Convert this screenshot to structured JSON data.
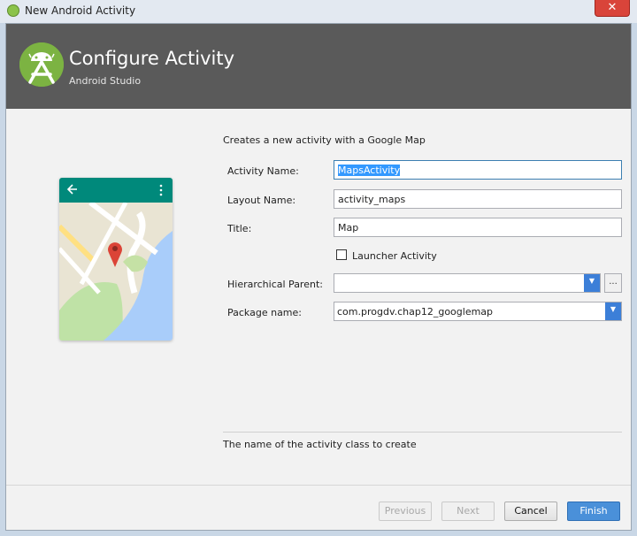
{
  "window": {
    "title": "New Android Activity",
    "close_label": "✕"
  },
  "header": {
    "title": "Configure Activity",
    "subtitle": "Android Studio"
  },
  "form": {
    "description": "Creates a new activity with a Google Map",
    "activity_name": {
      "label": "Activity Name:",
      "value": "MapsActivity"
    },
    "layout_name": {
      "label": "Layout Name:",
      "value": "activity_maps"
    },
    "title": {
      "label": "Title:",
      "value": "Map"
    },
    "launcher_activity": {
      "label": "Launcher Activity",
      "checked": false
    },
    "hierarchical_parent": {
      "label": "Hierarchical Parent:",
      "value": "",
      "browse_label": "..."
    },
    "package_name": {
      "label": "Package name:",
      "value": "com.progdv.chap12_googlemap"
    }
  },
  "hint": "The name of the activity class to create",
  "buttons": {
    "previous": "Previous",
    "next": "Next",
    "cancel": "Cancel",
    "finish": "Finish"
  },
  "colors": {
    "header_bg": "#5a5a5a",
    "accent": "#4a90d9",
    "android_green": "#7cb342",
    "map_toolbar": "#00897b"
  },
  "icons": [
    "android-studio-logo-icon",
    "back-arrow-icon",
    "overflow-menu-icon",
    "map-pin-icon",
    "dropdown-arrow-icon",
    "checkbox-icon"
  ]
}
